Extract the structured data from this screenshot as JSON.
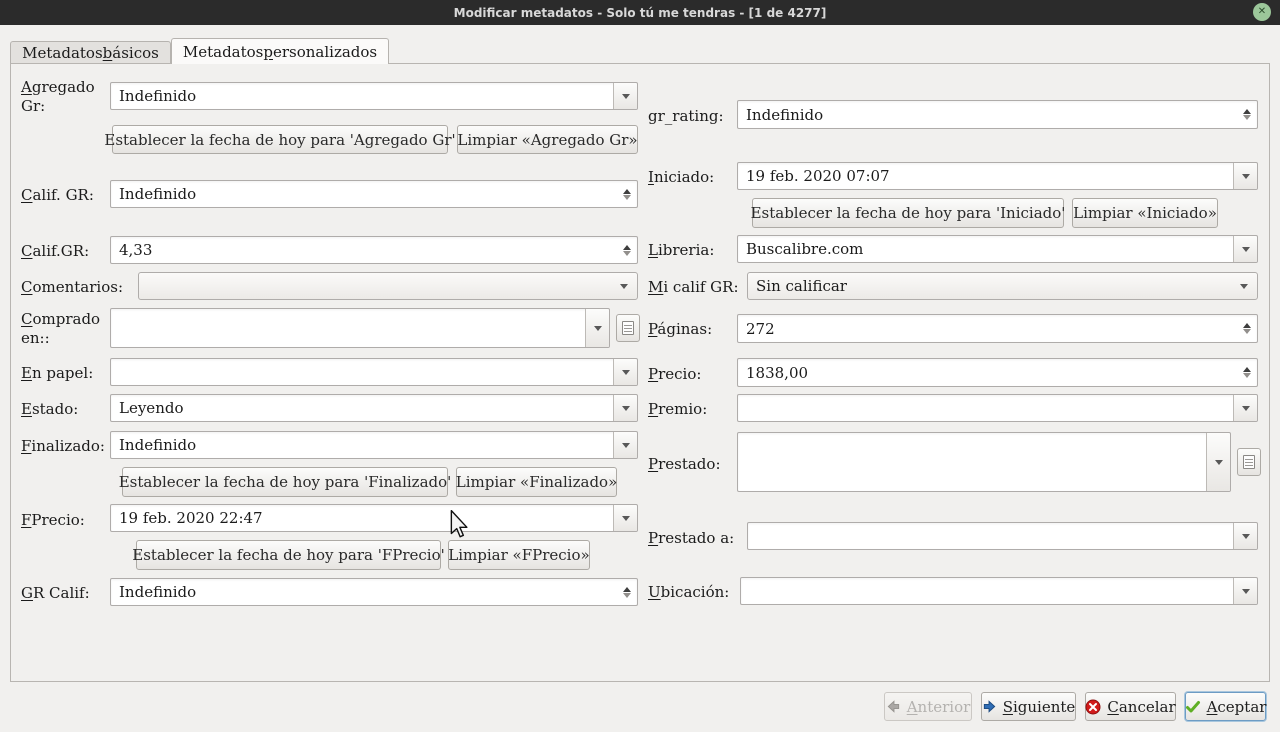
{
  "window": {
    "title": "Modificar metadatos - Solo tú me tendras - [1 de 4277]",
    "close_glyph": "✕"
  },
  "tabs": {
    "basic": {
      "t": "Metadatos básicos",
      "m": "b"
    },
    "custom": {
      "t": "Metadatos personalizados",
      "m": "p"
    }
  },
  "fields": {
    "agregado_gr": {
      "label": {
        "t": "Agregado Gr:",
        "m": "A"
      },
      "value": "Indefinido"
    },
    "calif_gr": {
      "label": {
        "t": "Calif. GR:",
        "m": "C"
      },
      "value": "Indefinido"
    },
    "calif_gr2": {
      "label": {
        "t": "Calif.GR:",
        "m": "C"
      },
      "value": "4,33"
    },
    "comentarios": {
      "label": {
        "t": "Comentarios:",
        "m": "C"
      },
      "value": ""
    },
    "comprado_en": {
      "label": {
        "t": "Comprado en::",
        "m": "C"
      },
      "value": ""
    },
    "en_papel": {
      "label": {
        "t": "En papel:",
        "m": "E"
      },
      "value": ""
    },
    "estado": {
      "label": {
        "t": "Estado:",
        "m": "E"
      },
      "value": "Leyendo"
    },
    "finalizado": {
      "label": {
        "t": "Finalizado:",
        "m": "F"
      },
      "value": "Indefinido"
    },
    "fprecio": {
      "label": {
        "t": "FPrecio:",
        "m": "F"
      },
      "value": "19 feb. 2020 22:47"
    },
    "gr_calif": {
      "label": {
        "t": "GR Calif:",
        "m": "G"
      },
      "value": "Indefinido"
    },
    "gr_rating": {
      "label": {
        "t": "gr_rating:",
        "m": ""
      },
      "value": "Indefinido"
    },
    "iniciado": {
      "label": {
        "t": "Iniciado:",
        "m": "I"
      },
      "value": "19 feb. 2020 07:07"
    },
    "libreria": {
      "label": {
        "t": "Libreria:",
        "m": "L"
      },
      "value": "Buscalibre.com"
    },
    "mi_calif_gr": {
      "label": {
        "t": "Mi calif GR:",
        "m": "M"
      },
      "value": "Sin calificar"
    },
    "paginas": {
      "label": {
        "t": "Páginas:",
        "m": "P"
      },
      "value": "272"
    },
    "precio": {
      "label": {
        "t": "Precio:",
        "m": "P"
      },
      "value": "1838,00"
    },
    "premio": {
      "label": {
        "t": "Premio:",
        "m": "P"
      },
      "value": ""
    },
    "prestado": {
      "label": {
        "t": "Prestado:",
        "m": "P"
      },
      "value": ""
    },
    "prestado_a": {
      "label": {
        "t": "Prestado a:",
        "m": "P"
      },
      "value": ""
    },
    "ubicacion": {
      "label": {
        "t": "Ubicación:",
        "m": "U"
      },
      "value": ""
    }
  },
  "action_buttons": {
    "set_agregado": "Establecer la fecha de hoy para 'Agregado Gr'",
    "clear_agregado": "Limpiar «Agregado Gr»",
    "set_finalizado": "Establecer la fecha de hoy para 'Finalizado'",
    "clear_finalizado": "Limpiar «Finalizado»",
    "set_fprecio": "Establecer la fecha de hoy para 'FPrecio'",
    "clear_fprecio": "Limpiar «FPrecio»",
    "set_iniciado": "Establecer la fecha de hoy para 'Iniciado'",
    "clear_iniciado": "Limpiar «Iniciado»"
  },
  "footer": {
    "anterior": {
      "t": "Anterior",
      "m": "A"
    },
    "siguiente": {
      "t": "Siguiente",
      "m": "S"
    },
    "cancelar": {
      "t": "Cancelar",
      "m": "C"
    },
    "aceptar": {
      "t": "Aceptar",
      "m": "A"
    }
  },
  "colors": {
    "titlebar": "#2b2b2b",
    "close_button_green": "#9cc79a",
    "next_arrow_blue": "#2f6db5",
    "cancel_red": "#d11a1a",
    "accept_green": "#5faf25"
  }
}
